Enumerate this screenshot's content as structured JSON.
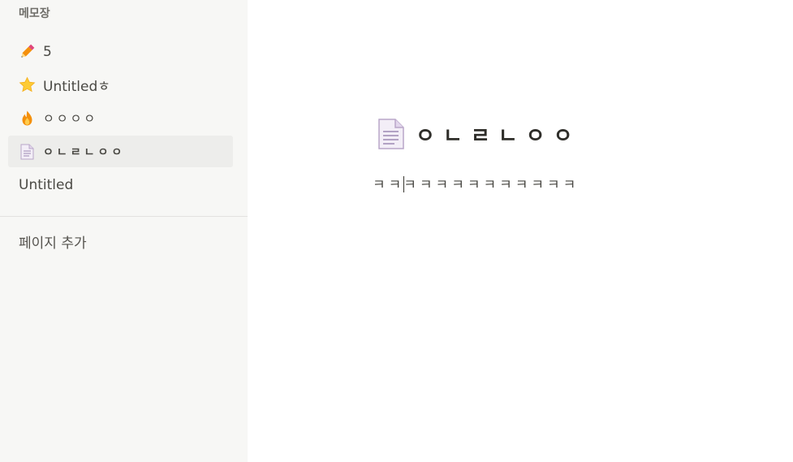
{
  "sidebar": {
    "title": "메모장",
    "pages": [
      {
        "icon": "pencil-icon",
        "label": "5"
      },
      {
        "icon": "star-icon",
        "label": "Untitledㅎ"
      },
      {
        "icon": "fire-icon",
        "label": "ㅇㅇㅇㅇ"
      },
      {
        "icon": "page-icon",
        "label": "ㅇㄴㄹㄴㅇㅇ",
        "active": true
      },
      {
        "icon": "",
        "label": "Untitled"
      }
    ],
    "add_page_label": "페이지 추가"
  },
  "document": {
    "icon": "page-icon",
    "title": "ㅇㄴㄹㄴㅇㅇ",
    "body_before_caret": "ㅋㅋ",
    "body_after_caret": "ㅋㅋㅋㅋㅋㅋㅋㅋㅋㅋㅋ"
  },
  "colors": {
    "sidebar_bg": "#f7f7f5",
    "active_item_bg": "#ededeb",
    "text": "#37352f"
  }
}
